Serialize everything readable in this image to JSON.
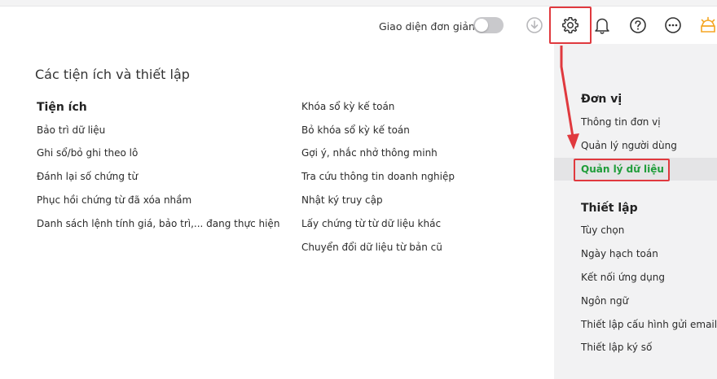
{
  "toolbar": {
    "simple_ui_label": "Giao diện đơn giản",
    "simple_ui_on": false,
    "icons": [
      "download-icon",
      "gear-icon",
      "bell-icon",
      "help-icon",
      "more-icon",
      "theme-icon"
    ]
  },
  "main": {
    "title": "Các tiện ích và thiết lập",
    "section_title": "Tiện ích",
    "left_items": [
      "Bảo trì dữ liệu",
      "Ghi sổ/bỏ ghi theo lô",
      "Đánh lại số chứng từ",
      "Phục hồi chứng từ đã xóa nhầm",
      "Danh sách lệnh tính giá, bảo trì,... đang thực hiện"
    ],
    "right_items": [
      "Khóa sổ kỳ kế toán",
      "Bỏ khóa sổ kỳ kế toán",
      "Gợi ý, nhắc nhở thông minh",
      "Tra cứu thông tin doanh nghiệp",
      "Nhật ký truy cập",
      "Lấy chứng từ từ dữ liệu khác",
      "Chuyển đổi dữ liệu từ bản cũ"
    ]
  },
  "sidebar": {
    "group1_title": "Đơn vị",
    "group1_items": [
      "Thông tin đơn vị",
      "Quản lý người dùng",
      "Quản lý dữ liệu"
    ],
    "group2_title": "Thiết lập",
    "group2_items": [
      "Tùy chọn",
      "Ngày hạch toán",
      "Kết nối ứng dụng",
      "Ngôn ngữ",
      "Thiết lập cấu hình gửi email",
      "Thiết lập ký số"
    ]
  },
  "colors": {
    "accent_green": "#1f9d3a",
    "highlight_red": "#e0393e",
    "theme_orange": "#f5a623"
  }
}
